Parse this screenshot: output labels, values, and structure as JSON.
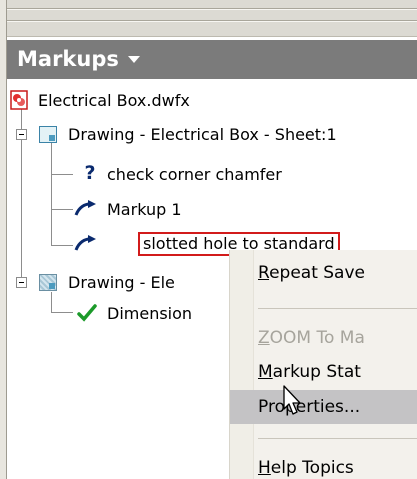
{
  "panel": {
    "title": "Markups"
  },
  "tree": {
    "root": {
      "label": "Electrical Box.dwfx",
      "icon": "dwfx-file-icon"
    },
    "sheet1": {
      "label": "Drawing - Electrical Box - Sheet:1",
      "icon": "sheet-icon"
    },
    "markups": [
      {
        "label": "check corner chamfer",
        "icon": "question-mark-icon"
      },
      {
        "label": "Markup 1",
        "icon": "curved-arrow-icon"
      },
      {
        "label": "slotted hole to standard",
        "icon": "curved-arrow-icon",
        "selected": true
      }
    ],
    "sheet2": {
      "label": "Drawing - Ele",
      "icon": "dotted-sheet-icon"
    },
    "sheet2_children": [
      {
        "label": "Dimension",
        "icon": "checkmark-icon"
      }
    ]
  },
  "context_menu": {
    "items": [
      {
        "label": "Repeat Save",
        "enabled": true
      },
      {
        "label": "ZOOM To Ma",
        "enabled": false
      },
      {
        "label": "Markup Stat",
        "enabled": true
      },
      {
        "label": "Properties...",
        "enabled": true,
        "hover": true
      },
      {
        "label": "Help Topics",
        "enabled": true
      }
    ]
  },
  "colors": {
    "header_bg": "#7b7b7b",
    "selection_border": "#d21b1b",
    "menu_hover": "#c4c3c5",
    "menu_bg": "#f3f1ec"
  }
}
